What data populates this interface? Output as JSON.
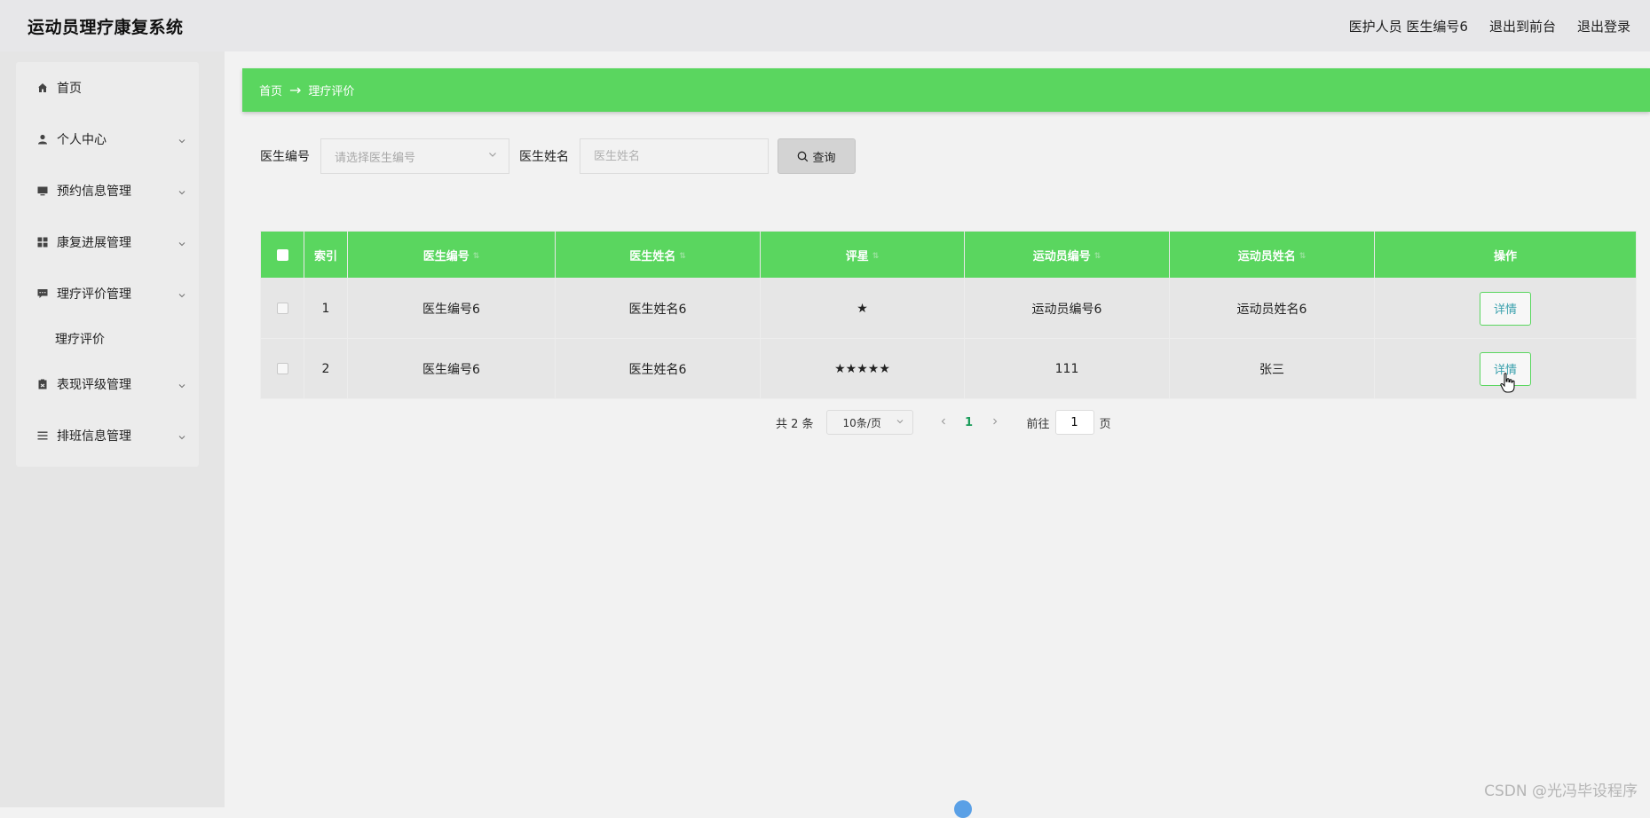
{
  "header": {
    "app_title": "运动员理疗康复系统",
    "user_role": "医护人员",
    "user_id": "医生编号6",
    "back_to_front": "退出到前台",
    "logout": "退出登录"
  },
  "sidebar": {
    "items": [
      {
        "label": "首页",
        "icon": "home-icon"
      },
      {
        "label": "个人中心",
        "icon": "user-icon"
      },
      {
        "label": "预约信息管理",
        "icon": "monitor-icon"
      },
      {
        "label": "康复进展管理",
        "icon": "grid-icon"
      },
      {
        "label": "理疗评价管理",
        "icon": "comment-icon"
      },
      {
        "label": "理疗评价",
        "sub": true
      },
      {
        "label": "表现评级管理",
        "icon": "clipboard-icon"
      },
      {
        "label": "排班信息管理",
        "icon": "list-icon"
      }
    ]
  },
  "breadcrumb": {
    "home": "首页",
    "arrow": "→",
    "current": "理疗评价"
  },
  "search": {
    "doctor_id_label": "医生编号",
    "doctor_id_placeholder": "请选择医生编号",
    "doctor_name_label": "医生姓名",
    "doctor_name_placeholder": "医生姓名",
    "query_button": "查询"
  },
  "table": {
    "columns": [
      "索引",
      "医生编号",
      "医生姓名",
      "评星",
      "运动员编号",
      "运动员姓名",
      "操作"
    ],
    "rows": [
      {
        "index": "1",
        "doctor_id": "医生编号6",
        "doctor_name": "医生姓名6",
        "rating": "★",
        "athlete_id": "运动员编号6",
        "athlete_name": "运动员姓名6",
        "action": "详情"
      },
      {
        "index": "2",
        "doctor_id": "医生编号6",
        "doctor_name": "医生姓名6",
        "rating": "★★★★★",
        "athlete_id": "111",
        "athlete_name": "张三",
        "action": "详情"
      }
    ]
  },
  "pagination": {
    "total": "共 2 条",
    "page_size": "10条/页",
    "current_page": "1",
    "goto_label": "前往",
    "goto_value": "1",
    "page_unit": "页"
  },
  "watermark": "CSDN @光冯毕设程序",
  "colors": {
    "accent_green": "#5ad65f",
    "link_teal": "#3aa0ad",
    "active_page": "#1a9c5a"
  }
}
